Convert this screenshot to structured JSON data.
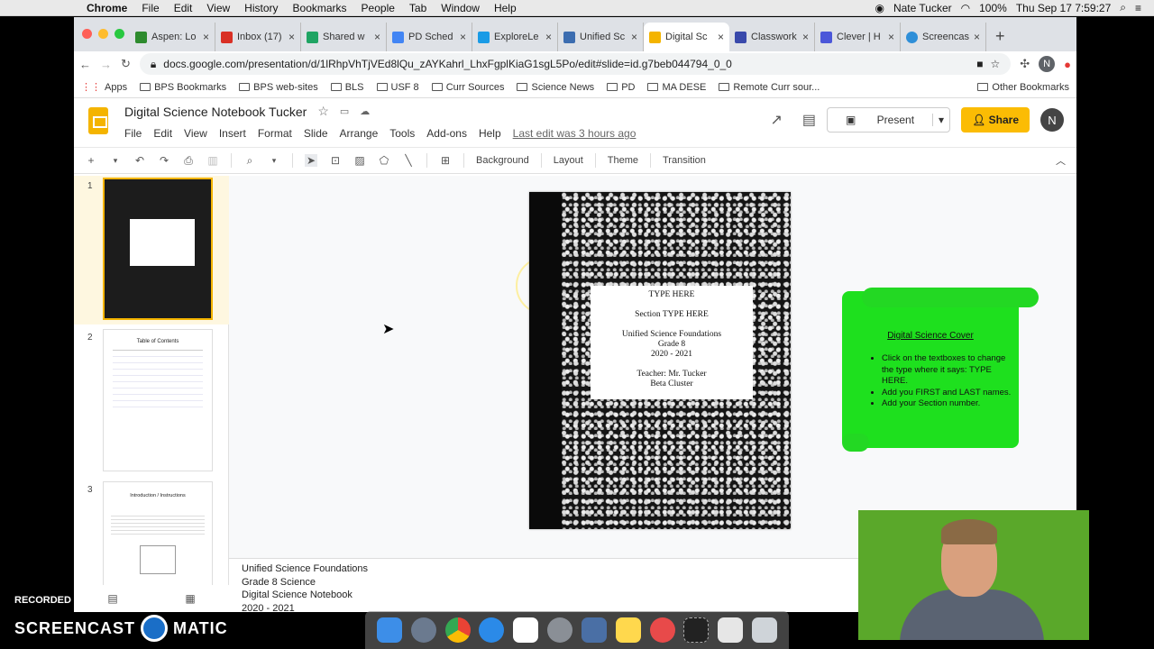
{
  "mac": {
    "app": "Chrome",
    "menus": [
      "File",
      "Edit",
      "View",
      "History",
      "Bookmarks",
      "People",
      "Tab",
      "Window",
      "Help"
    ],
    "user": "Nate Tucker",
    "battery": "100%",
    "datetime": "Thu Sep 17  7:59:27"
  },
  "tabs": [
    {
      "label": "Aspen: Lo",
      "color": "#2e8b2e"
    },
    {
      "label": "Inbox (17)",
      "color": "#d93025"
    },
    {
      "label": "Shared w",
      "color": "#1fa463"
    },
    {
      "label": "PD Sched",
      "color": "#4285f4"
    },
    {
      "label": "ExploreLe",
      "color": "#1a9be6"
    },
    {
      "label": "Unified Sc",
      "color": "#3c6db0"
    },
    {
      "label": "Digital Sc",
      "color": "#f4b400"
    },
    {
      "label": "Classwork",
      "color": "#3949ab"
    },
    {
      "label": "Clever | H",
      "color": "#4b57d9"
    },
    {
      "label": "Screencas",
      "color": "#2f8fd8"
    }
  ],
  "url": "docs.google.com/presentation/d/1lRhpVhTjVEd8lQu_zAYKahrl_LhxFgplKiaG1sgL5Po/edit#slide=id.g7beb044794_0_0",
  "bookmarks": [
    "Apps",
    "BPS Bookmarks",
    "BPS web-sites",
    "BLS",
    "USF 8",
    "Curr Sources",
    "Science News",
    "PD",
    "MA DESE",
    "Remote Curr sour..."
  ],
  "other_bookmarks": "Other Bookmarks",
  "doc": {
    "title": "Digital Science Notebook Tucker",
    "menus": [
      "File",
      "Edit",
      "View",
      "Insert",
      "Format",
      "Slide",
      "Arrange",
      "Tools",
      "Add-ons",
      "Help"
    ],
    "last_edit": "Last edit was 3 hours ago",
    "present": "Present",
    "share": "Share",
    "avatar": "N"
  },
  "toolbar": {
    "background": "Background",
    "layout": "Layout",
    "theme": "Theme",
    "transition": "Transition"
  },
  "thumbs": {
    "n1": "1",
    "n2": "2",
    "n3": "3",
    "t2": "Table of Contents",
    "t3": "Introduction / Instructions"
  },
  "slide": {
    "l1": "TYPE HERE",
    "l2": "Section TYPE HERE",
    "l3": "Unified Science Foundations",
    "l4": "Grade 8",
    "l5": "2020 - 2021",
    "l6": "Teacher: Mr. Tucker",
    "l7": "Beta Cluster"
  },
  "note": {
    "title": "Digital Science Cover",
    "b1": "Click on the textboxes to change the type where it says: TYPE HERE.",
    "b2": "Add you FIRST and LAST names.",
    "b3": "Add your Section number."
  },
  "speaker_notes": {
    "l1": "Unified Science Foundations",
    "l2": "Grade 8 Science",
    "l3": "Digital Science Notebook",
    "l4": "2020 - 2021"
  },
  "watermark": {
    "top": "RECORDED WITH",
    "bottom": "SCREENCAST",
    "suffix": "MATIC"
  }
}
